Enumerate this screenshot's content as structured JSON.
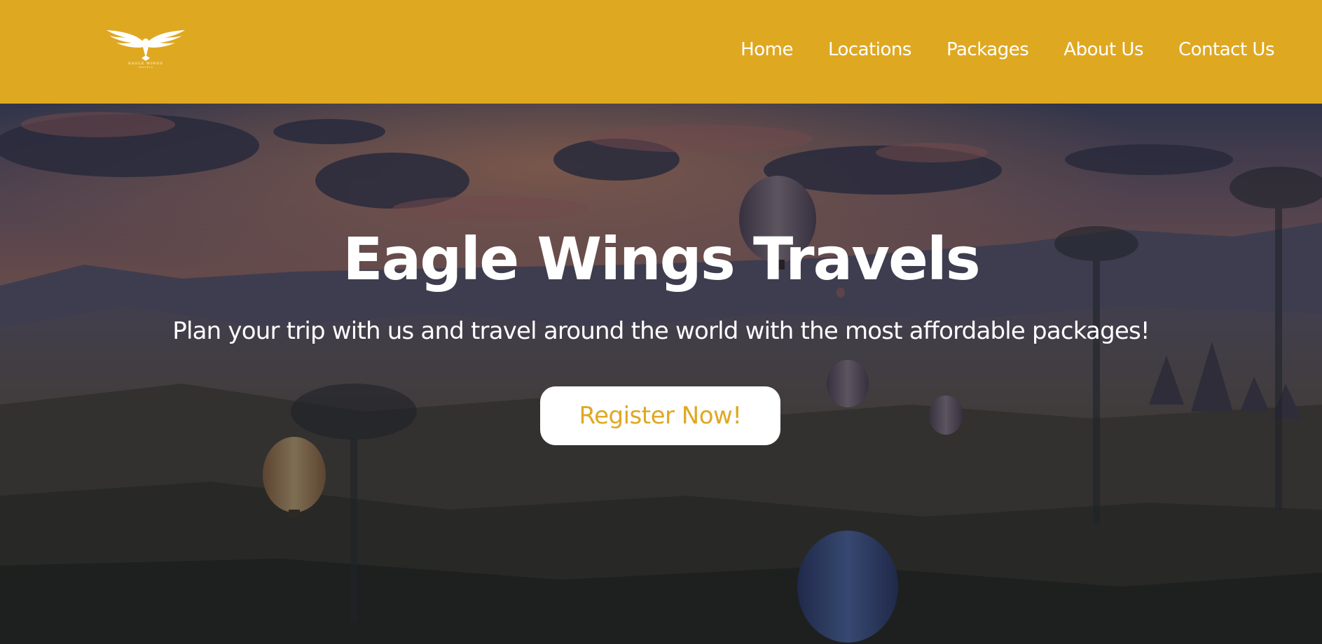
{
  "brand": {
    "logo_icon": "eagle-wings-logo-icon",
    "logo_text": "EAGLE WINGS",
    "logo_subtext": "TRAVELS",
    "accent_color": "#DFA821"
  },
  "nav": {
    "items": [
      {
        "label": "Home"
      },
      {
        "label": "Locations"
      },
      {
        "label": "Packages"
      },
      {
        "label": "About Us"
      },
      {
        "label": "Contact Us"
      }
    ]
  },
  "hero": {
    "title": "Eagle Wings Travels",
    "subtitle": "Plan your trip with us and travel around the world with the most affordable packages!",
    "cta_label": "Register Now!",
    "background_image": "hot-air-balloons-over-valley-at-sunset"
  }
}
